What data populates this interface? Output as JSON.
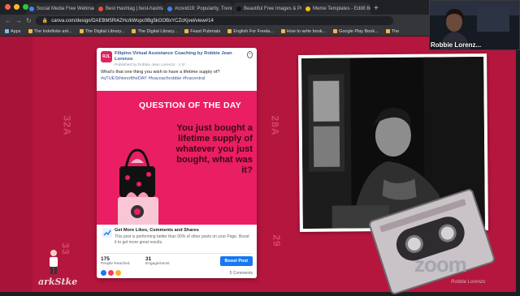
{
  "browser": {
    "tabs": [
      {
        "title": "Social Media Free Webinar",
        "color": "#4285f4",
        "active": false
      },
      {
        "title": "Best Hashtag | best-hashtag",
        "color": "#e94b3c",
        "active": false
      },
      {
        "title": "#covid19: Popularity, Trend, n",
        "color": "#3b82f6",
        "active": false
      },
      {
        "title": "Beautiful Free Images & Pictur",
        "color": "#111111",
        "active": false
      },
      {
        "title": "Meme Templates - Edit8 Best",
        "color": "#f4c20d",
        "active": false
      }
    ],
    "url": "canva.com/design/DAEBM5Ri4ZHc/kWopc0Bg5kOOBxYCZcKjvel/view#14",
    "bookmarks": [
      "Apps",
      "The Indefinite arti...",
      "The Digital Library...",
      "The Digital Library...",
      "Feast Pubmats",
      "English For Freela...",
      "How to write book...",
      "Google Play Book...",
      "The"
    ]
  },
  "video": {
    "name": "Robbie Lorenz..."
  },
  "canvas_deco": {
    "left_label": "32A",
    "mid_label": "28A",
    "bottom_left": "33",
    "bottom_mid": "29"
  },
  "post": {
    "page_name": "Filipino Virtual Assistance Coaching by Robbie Jean Lorenzo",
    "meta": "Published by Robbie Jean Lorenzo · 1 hr · ",
    "avatar_text": "RJL",
    "text": "What's that one thing you wish to have a lifetime supply of?",
    "tags": "#qTUESthionoftheDAY #fvacoachrobbie #fvacentral",
    "image": {
      "heading": "QUESTION OF THE DAY",
      "body": "You just bought a lifetime supply of whatever you just bought, what was it?"
    },
    "boost": {
      "heading": "Get More Likes, Comments and Shares",
      "text": "This post is performing better than 90% of other posts on your Page. Boost it to get more great results.",
      "reached_value": "175",
      "reached_label": "People Reached",
      "engagements_value": "31",
      "engagements_label": "Engagements",
      "button": "Boost Post",
      "comments": "5 Comments"
    }
  },
  "watermark": {
    "left": "arkStke",
    "right": "Robbie Lorenzo",
    "zoom": "zoom"
  },
  "colors": {
    "canvas": "#b5163d",
    "post_image": "#ea1e63",
    "link": "#385898",
    "boost": "#1877f2"
  }
}
